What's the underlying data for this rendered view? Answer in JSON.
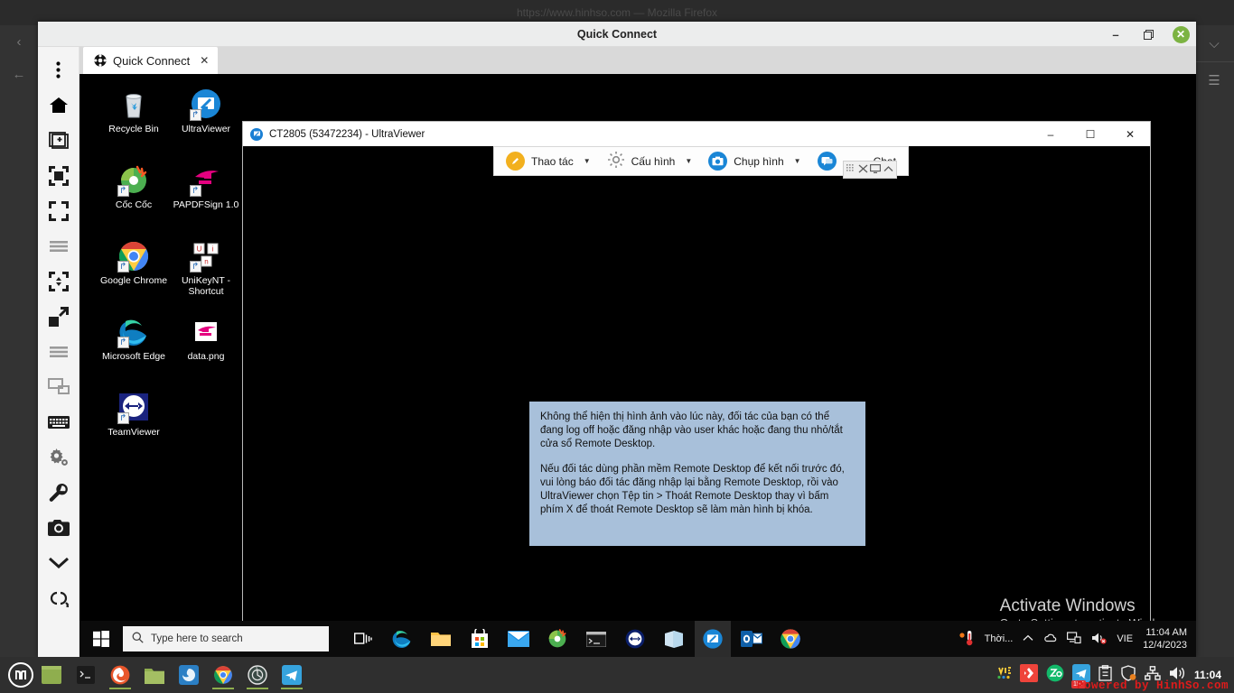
{
  "backdrop": {
    "browser_title": "https://www.hinhso.com — Mozilla Firefox",
    "left_rail": [
      {
        "name": "back-chevron-icon",
        "glyph": "‹"
      },
      {
        "name": "back-arrow-icon",
        "glyph": "←"
      }
    ],
    "right_rail": [
      {
        "name": "chevron-down-icon",
        "glyph": "⌄"
      },
      {
        "name": "hamburger-menu-icon",
        "glyph": "☰"
      }
    ]
  },
  "viewer_window": {
    "title": "Quick Connect",
    "controls": {
      "minimize": "–",
      "maximize": "❐",
      "close": "✕"
    },
    "tool_rail": [
      {
        "name": "more-options-icon",
        "label": "More options"
      },
      {
        "name": "home-icon",
        "label": "Home"
      },
      {
        "name": "new-session-icon",
        "label": "New session"
      },
      {
        "name": "fit-to-screen-icon",
        "label": "Fit to screen"
      },
      {
        "name": "actual-size-icon",
        "label": "Actual size"
      },
      {
        "name": "list-lines-icon",
        "label": "Quality"
      },
      {
        "name": "scroll-mode-icon",
        "label": "Scroll mode"
      },
      {
        "name": "fullscreen-icon",
        "label": "Full screen"
      },
      {
        "name": "list-lines2-icon",
        "label": "Options list"
      },
      {
        "name": "multi-monitor-icon",
        "label": "Monitors"
      },
      {
        "name": "keyboard-icon",
        "label": "Virtual keyboard"
      },
      {
        "name": "settings-gear-icon",
        "label": "Settings"
      },
      {
        "name": "tools-wrench-icon",
        "label": "Tools"
      },
      {
        "name": "camera-icon",
        "label": "Screenshot"
      },
      {
        "name": "chevron-down-icon",
        "label": "More"
      },
      {
        "name": "chain-link-icon",
        "label": "Disconnect"
      }
    ],
    "tabs": [
      {
        "label": "Quick Connect",
        "icon": "target-icon",
        "close": "✕",
        "active": true
      }
    ]
  },
  "remote_desktop": {
    "desktop_icons": [
      {
        "label": "Recycle Bin",
        "icon": "recycle-bin-icon",
        "shortcut": false
      },
      {
        "label": "UltraViewer",
        "icon": "ultraviewer-icon",
        "shortcut": true
      },
      {
        "label": "Cốc Cốc",
        "icon": "coccoc-icon",
        "shortcut": true
      },
      {
        "label": "PAPDFSign 1.0",
        "icon": "papdfsign-icon",
        "shortcut": true
      },
      {
        "label": "Google Chrome",
        "icon": "chrome-icon",
        "shortcut": true
      },
      {
        "label": "UniKeyNT - Shortcut",
        "icon": "unikey-icon",
        "shortcut": true
      },
      {
        "label": "Microsoft Edge",
        "icon": "edge-icon",
        "shortcut": true
      },
      {
        "label": "data.png",
        "icon": "image-file-icon",
        "shortcut": false
      },
      {
        "label": "TeamViewer",
        "icon": "teamviewer-icon",
        "shortcut": true
      }
    ],
    "activation_watermark": {
      "line1": "Activate Windows",
      "line2": "Go to Settings to activate Windows."
    },
    "taskbar": {
      "search_placeholder": "Type here to search",
      "start_icon": "windows-start-icon",
      "search_icon": "search-icon",
      "pinned": [
        {
          "name": "task-view-icon"
        },
        {
          "name": "microsoft-edge-icon"
        },
        {
          "name": "file-explorer-icon"
        },
        {
          "name": "microsoft-store-icon"
        },
        {
          "name": "mail-icon"
        },
        {
          "name": "coccoc-icon"
        },
        {
          "name": "command-prompt-icon"
        },
        {
          "name": "teamviewer-icon"
        },
        {
          "name": "sticky-notes-icon"
        },
        {
          "name": "ultraviewer-icon"
        },
        {
          "name": "outlook-icon"
        },
        {
          "name": "chrome-icon"
        }
      ],
      "tray": {
        "weather_icon": "thermometer-icon",
        "weather_label": "Thời...",
        "show_hidden_icon": "chevron-up-icon",
        "onedrive_icon": "onedrive-icon",
        "network_icon": "network-monitor-icon",
        "volume_icon": "speaker-muted-icon",
        "language": "VIE",
        "time": "11:04 AM",
        "date": "12/4/2023"
      }
    },
    "ultraviewer": {
      "title": "CT2805 (53472234) - UltraViewer",
      "controls": {
        "minimize": "–",
        "maximize": "☐",
        "close": "✕"
      },
      "toolbar": [
        {
          "label": "Thao tác",
          "icon": "pencil-circle-icon",
          "has_caret": true
        },
        {
          "label": "Cấu hình",
          "icon": "gear-icon",
          "has_caret": true
        },
        {
          "label": "Chụp hình",
          "icon": "camera-circle-icon",
          "has_caret": true
        },
        {
          "label": "Chat",
          "icon": "chat-bubble-icon",
          "has_caret": false
        }
      ],
      "mini_controls": [
        {
          "name": "grid-dots-icon",
          "glyph": "░"
        },
        {
          "name": "shuffle-icon",
          "glyph": "✕"
        },
        {
          "name": "monitor-icon",
          "glyph": "▭"
        },
        {
          "name": "chevron-up-icon",
          "glyph": "⌃"
        }
      ],
      "message": {
        "paragraph1": "Không thể hiện thị hình ảnh vào lúc này, đối tác của bạn có thể đang log off hoặc đăng nhập vào user khác hoặc đang thu nhỏ/tắt cửa sổ Remote Desktop.",
        "paragraph2": "Nếu đối tác dùng phần mềm Remote Desktop để kết nối trước đó, vui lòng báo đối tác đăng nhập lại bằng Remote Desktop, rồi vào UltraViewer chọn Tệp tin > Thoát Remote Desktop thay vì bấm phím X để thoát Remote Desktop sẽ làm màn hình bị khóa."
      }
    }
  },
  "host_panel": {
    "menu_icon": "linux-mint-menu-icon",
    "launchers": [
      {
        "name": "show-desktop-icon",
        "running": false
      },
      {
        "name": "terminal-icon",
        "running": false
      },
      {
        "name": "firefox-icon",
        "running": true
      },
      {
        "name": "files-icon",
        "running": false
      },
      {
        "name": "gimp-icon",
        "running": false
      },
      {
        "name": "chrome-icon",
        "running": true
      },
      {
        "name": "viewer-app-icon",
        "running": true
      },
      {
        "name": "telegram-icon",
        "running": true
      }
    ],
    "tray": [
      {
        "name": "input-method-icon"
      },
      {
        "name": "anydesk-icon"
      },
      {
        "name": "zalo-icon"
      },
      {
        "name": "telegram-badge-icon",
        "badge": "157"
      },
      {
        "name": "clipboard-icon"
      },
      {
        "name": "shield-icon"
      },
      {
        "name": "network-icon"
      },
      {
        "name": "volume-icon"
      }
    ],
    "clock": "11:04",
    "footer_brand": "Powered by HinhSo.com"
  },
  "colors": {
    "mint_panel": "#2f2f2f",
    "windows_taskbar": "#0b0b0b",
    "msgbox_bg": "#a8c0da",
    "accent_blue": "#1a86d6",
    "accent_orange": "#f2b01e",
    "close_green": "#7cb342",
    "brand_red": "#e01b1b"
  }
}
